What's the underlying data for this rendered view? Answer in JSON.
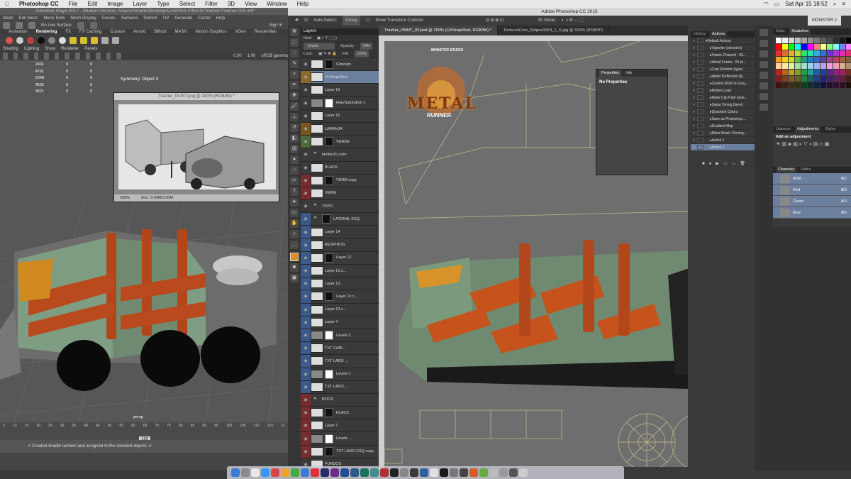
{
  "menubar": {
    "apple": "",
    "app": "Photoshop CC",
    "items": [
      "File",
      "Edit",
      "Image",
      "Layer",
      "Type",
      "Select",
      "Filter",
      "3D",
      "View",
      "Window",
      "Help"
    ],
    "clock": "Sat Apr 15  18:52"
  },
  "maya": {
    "title": "Autodesk Maya 2017 - Student Version: /Users/rizzatto/Desktop/CARROS FINAIS/Trasher/Trasher.005.mb*",
    "menu": [
      "Mesh",
      "Edit Mesh",
      "Mesh Tools",
      "Mesh Display",
      "Curves",
      "Surfaces",
      "Deform",
      "UV",
      "Generate",
      "Cache",
      "Help"
    ],
    "live_label": "No Live Surface",
    "sign_in": "Sign In",
    "shelf_tabs": [
      "Animation",
      "Rendering",
      "FX",
      "FX Caching",
      "Custom",
      "Arnold",
      "Bifrost",
      "MASH",
      "Motion Graphics",
      "XGen",
      "RenderMan"
    ],
    "panel_menu": [
      "Shading",
      "Lighting",
      "Show",
      "Renderer",
      "Panels"
    ],
    "gamma": "sRGB gamma",
    "field_a": "0.00",
    "field_b": "1.00",
    "stats": [
      [
        "2401",
        "0",
        "0"
      ],
      [
        "4701",
        "0",
        "0"
      ],
      [
        "2348",
        "0",
        "0"
      ],
      [
        "4532",
        "0",
        "0"
      ],
      [
        "3621",
        "0",
        "0"
      ]
    ],
    "symmetry": "Symmetry: Object X",
    "camera": "persp",
    "frame": "120",
    "cmd": "// Created shader lambert and assigned to the selected objects. //",
    "ticks": [
      "5",
      "10",
      "15",
      "20",
      "25",
      "30",
      "35",
      "40",
      "45",
      "50",
      "55",
      "60",
      "65",
      "70",
      "75",
      "80",
      "85",
      "90",
      "95",
      "100",
      "105",
      "110",
      "115",
      "12"
    ]
  },
  "paintwin": {
    "title": "Trasher_PAINT.png @ 200% (RGB/8#) *",
    "zoom": "200%",
    "doc": "Doc: 3.00M/3.00M"
  },
  "ps": {
    "title": "Adobe Photoshop CC 2015",
    "options": {
      "auto_select": "Auto-Select:",
      "group": "Group",
      "transform": "Show Transform Controls",
      "mode3d": "3D Mode:"
    },
    "workspace": "MONSTER 2",
    "tabs": [
      "Trasher_PAINT_02.psd @ 200% (UVSnapShot, RGB/8#) *",
      "TexturesCom_Stripes0063_1_S.jpg @ 100% (RGB/8*)"
    ],
    "logo_top": "MONSTER STUDIO",
    "logo_main": "METAL",
    "logo_sub": "RUNNER"
  },
  "layers": {
    "panel": "Layers",
    "kind": "Kind",
    "blend": "Divide",
    "opacity_label": "Opacity:",
    "opacity": "34%",
    "lock_label": "Lock:",
    "fill_label": "Fill:",
    "fill": "100%",
    "rows": [
      {
        "name": "Concept",
        "color": "#3a3a3a",
        "type": "layer",
        "sel": false
      },
      {
        "name": "UVSnapShot",
        "color": "#8a6a2a",
        "type": "layer",
        "sel": true
      },
      {
        "name": "Layer 16",
        "color": "#3a3a3a",
        "type": "layer",
        "sel": false
      },
      {
        "name": "Hue/Saturation 1",
        "color": "#3a3a3a",
        "type": "adj",
        "sel": false
      },
      {
        "name": "Layer 15",
        "color": "#3a3a3a",
        "type": "layer",
        "sel": false
      },
      {
        "name": "LARANJA",
        "color": "#7a5520",
        "type": "layer",
        "sel": false
      },
      {
        "name": "VERDE",
        "color": "#4e6a3a",
        "type": "layer",
        "sel": false
      },
      {
        "name": "lambert1.color",
        "color": "#3a3a3a",
        "type": "group",
        "sel": false
      },
      {
        "name": "BLACK",
        "color": "#3a3a3a",
        "type": "layer",
        "sel": false
      },
      {
        "name": "VERM copy",
        "color": "#7a2c2c",
        "type": "layer",
        "sel": false
      },
      {
        "name": "VERM",
        "color": "#7a2c2c",
        "type": "layer",
        "sel": false
      },
      {
        "name": "TOPO",
        "color": "#3a3a3a",
        "type": "group",
        "sel": false
      },
      {
        "name": "LATERAL ESQ",
        "color": "#3a5a8a",
        "type": "group",
        "sel": false
      },
      {
        "name": "Layer 14",
        "color": "#3a5a8a",
        "type": "layer",
        "sel": false
      },
      {
        "name": "RESPIROS",
        "color": "#3a5a8a",
        "type": "layer",
        "sel": false
      },
      {
        "name": "Layer 12",
        "color": "#3a5a8a",
        "type": "layer",
        "sel": false
      },
      {
        "name": "Layer 13 c...",
        "color": "#3a5a8a",
        "type": "layer",
        "sel": false
      },
      {
        "name": "Layer 13",
        "color": "#3a5a8a",
        "type": "layer",
        "sel": false
      },
      {
        "name": "Layer 13 c...",
        "color": "#3a5a8a",
        "type": "layer",
        "sel": false
      },
      {
        "name": "Layer 13 c...",
        "color": "#3a5a8a",
        "type": "layer",
        "sel": false
      },
      {
        "name": "Layer 4",
        "color": "#3a5a8a",
        "type": "layer",
        "sel": false
      },
      {
        "name": "Levels 2",
        "color": "#3a5a8a",
        "type": "adj",
        "sel": false
      },
      {
        "name": "TXT CABI...",
        "color": "#3a5a8a",
        "type": "layer",
        "sel": false
      },
      {
        "name": "TXT LADO ...",
        "color": "#3a5a8a",
        "type": "layer",
        "sel": false
      },
      {
        "name": "Levels 1",
        "color": "#3a5a8a",
        "type": "adj",
        "sel": false
      },
      {
        "name": "TXT LADO ...",
        "color": "#3a5a8a",
        "type": "layer",
        "sel": false
      },
      {
        "name": "BOCA",
        "color": "#7a2c2c",
        "type": "group",
        "sel": false
      },
      {
        "name": "BLACK",
        "color": "#7a2c2c",
        "type": "layer",
        "sel": false
      },
      {
        "name": "Layer 7",
        "color": "#7a2c2c",
        "type": "layer",
        "sel": false
      },
      {
        "name": "Levels ...",
        "color": "#7a2c2c",
        "type": "adj",
        "sel": false
      },
      {
        "name": "TXT LADO ESQ copy",
        "color": "#7a2c2c",
        "type": "layer",
        "sel": false
      },
      {
        "name": "FUNDOS",
        "color": "#3a3a3a",
        "type": "layer",
        "sel": false
      },
      {
        "name": "Layer 1",
        "color": "#3a3a3a",
        "type": "layer",
        "sel": false
      }
    ]
  },
  "properties": {
    "tabs": [
      "Properties",
      "Info"
    ],
    "body": "No Properties"
  },
  "actions": {
    "tabs": [
      "History",
      "Actions"
    ],
    "rows": [
      "Default Actions",
      "Vignette (selection)",
      "Frame Channel - 50...",
      "Wood Frame - 50 pi...",
      "Cast Shadow (type)",
      "Water Reflection (ty...",
      "Custom RGB to Gray...",
      "Molten Lead",
      "Make Clip Path (sele...",
      "Sepia Toning (layer)",
      "Quadrant Colors",
      "Save as Photoshop ...",
      "Gradient Map",
      "Mixer Brush Cloning...",
      "Action 1",
      "Action 2"
    ]
  },
  "color": {
    "tabs": [
      "Color",
      "Swatches"
    ],
    "swatches": [
      "#ffffff",
      "#f0f0f0",
      "#d8d8d8",
      "#c0c0c0",
      "#a8a8a8",
      "#909090",
      "#787878",
      "#606060",
      "#484848",
      "#303030",
      "#181818",
      "#000000",
      "#ff0000",
      "#ffff00",
      "#00ff00",
      "#00ffff",
      "#0000ff",
      "#ff00ff",
      "#ff8080",
      "#ffff80",
      "#80ff80",
      "#80ffff",
      "#8080ff",
      "#ff80ff",
      "#e03030",
      "#e07030",
      "#e0b030",
      "#b0e030",
      "#30e070",
      "#30e0b0",
      "#30b0e0",
      "#3070e0",
      "#7030e0",
      "#b030e0",
      "#e030b0",
      "#e03070",
      "#f4a020",
      "#f4d020",
      "#c8e020",
      "#60c040",
      "#20a080",
      "#2080c0",
      "#4060c0",
      "#6040a0",
      "#a04090",
      "#c04060",
      "#a06040",
      "#806040",
      "#ffd0a0",
      "#ffe8a0",
      "#e0f0a0",
      "#a0e0a0",
      "#a0e0d0",
      "#a0d0f0",
      "#a0b0f0",
      "#c0a0f0",
      "#f0a0e0",
      "#f0a0b0",
      "#d0b090",
      "#b09070",
      "#c02020",
      "#c06020",
      "#c0a020",
      "#80a020",
      "#20a040",
      "#20a0a0",
      "#2060a0",
      "#2040a0",
      "#602090",
      "#902080",
      "#a02060",
      "#703020",
      "#802020",
      "#804020",
      "#806020",
      "#606020",
      "#208040",
      "#206060",
      "#204080",
      "#202080",
      "#402070",
      "#602060",
      "#602040",
      "#402018",
      "#401010",
      "#402010",
      "#403010",
      "#303010",
      "#104020",
      "#103030",
      "#102040",
      "#101040",
      "#201030",
      "#301030",
      "#301020",
      "#201008"
    ]
  },
  "adjustments": {
    "tabs": [
      "Libraries",
      "Adjustments",
      "Styles"
    ],
    "add": "Add an adjustment"
  },
  "channels": {
    "tabs": [
      "Channels",
      "Paths"
    ],
    "rows": [
      {
        "name": "RGB",
        "key": "⌘2"
      },
      {
        "name": "Red",
        "key": "⌘3"
      },
      {
        "name": "Green",
        "key": "⌘4"
      },
      {
        "name": "Blue",
        "key": "⌘5"
      }
    ]
  },
  "colors": {
    "selection": "#6b7f9e",
    "accent_orange": "#c5531b",
    "truck_green": "#7e9a7e"
  }
}
